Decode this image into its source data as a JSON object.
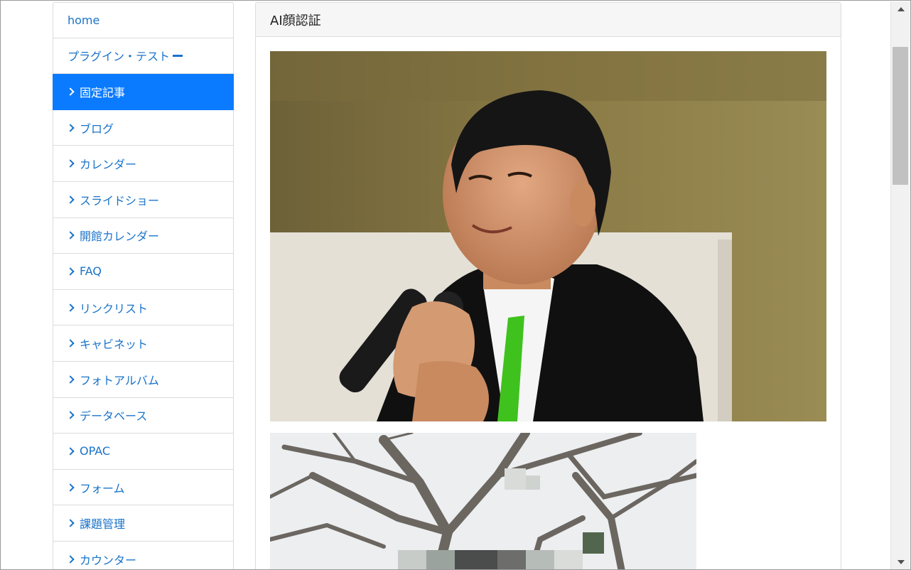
{
  "sidebar": {
    "items": [
      {
        "label": "home",
        "chevron": false,
        "active": false
      },
      {
        "label": "プラグイン・テスト",
        "chevron": false,
        "active": false,
        "trailing_dash": true
      },
      {
        "label": "固定記事",
        "chevron": true,
        "active": true
      },
      {
        "label": "ブログ",
        "chevron": true,
        "active": false
      },
      {
        "label": "カレンダー",
        "chevron": true,
        "active": false
      },
      {
        "label": "スライドショー",
        "chevron": true,
        "active": false
      },
      {
        "label": "開館カレンダー",
        "chevron": true,
        "active": false
      },
      {
        "label": "FAQ",
        "chevron": true,
        "active": false
      },
      {
        "label": "リンクリスト",
        "chevron": true,
        "active": false
      },
      {
        "label": "キャビネット",
        "chevron": true,
        "active": false
      },
      {
        "label": "フォトアルバム",
        "chevron": true,
        "active": false
      },
      {
        "label": "データベース",
        "chevron": true,
        "active": false
      },
      {
        "label": "OPAC",
        "chevron": true,
        "active": false
      },
      {
        "label": "フォーム",
        "chevron": true,
        "active": false
      },
      {
        "label": "課題管理",
        "chevron": true,
        "active": false
      },
      {
        "label": "カウンター",
        "chevron": true,
        "active": false
      }
    ]
  },
  "panel": {
    "title": "AI顔認証"
  },
  "colors": {
    "link": "#1a73c9",
    "active_bg": "#0a7bff",
    "panel_header_bg": "#f6f6f6",
    "border": "#dcdcdc"
  },
  "icons": {
    "nav_chevron": "chevron-right-icon",
    "scroll_up": "triangle-up-icon",
    "scroll_down": "triangle-down-icon"
  }
}
